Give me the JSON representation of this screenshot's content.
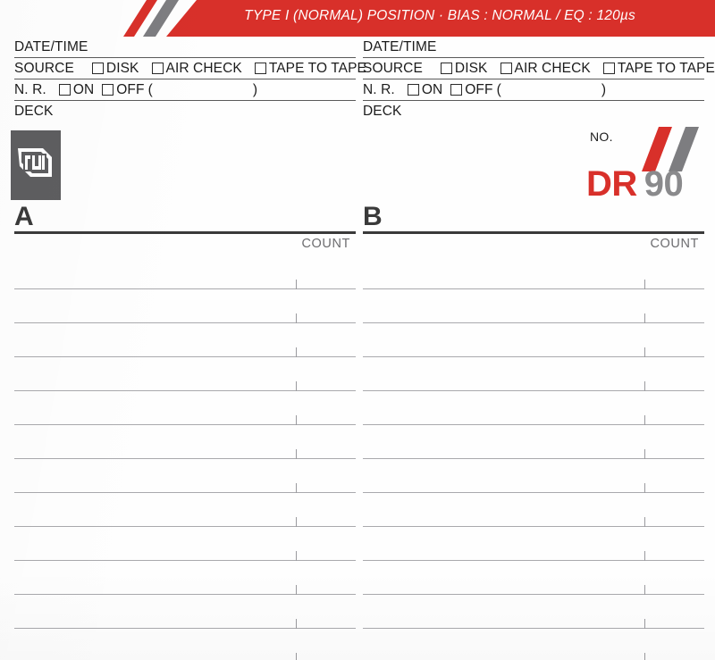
{
  "card": {
    "banner_text": "TYPE I (NORMAL) POSITION · BIAS : NORMAL / EQ : 120µs",
    "brand": {
      "no_label": "NO.",
      "name": "DR",
      "length": "90"
    },
    "logo_name": "FUJI"
  },
  "colors": {
    "red": "#d8302a",
    "gray": "#7d7d80",
    "logo_bg": "#5e5e60",
    "rule": "#5a5a5a",
    "line": "#a9a9ad",
    "text": "#1c1c1c"
  },
  "form": {
    "rows": {
      "date_time": "DATE/TIME",
      "source": "SOURCE",
      "nr": "N. R.",
      "deck": "DECK"
    },
    "source_options": [
      "DISK",
      "AIR CHECK",
      "TAPE TO TAPE"
    ],
    "nr_options": [
      "ON",
      "OFF"
    ],
    "nr_paren_open": "(",
    "nr_paren_close": ")"
  },
  "panels": [
    {
      "id": "a",
      "side_letter": "A",
      "count_label": "COUNT",
      "line_count": 12
    },
    {
      "id": "b",
      "side_letter": "B",
      "count_label": "COUNT",
      "line_count": 12
    }
  ]
}
